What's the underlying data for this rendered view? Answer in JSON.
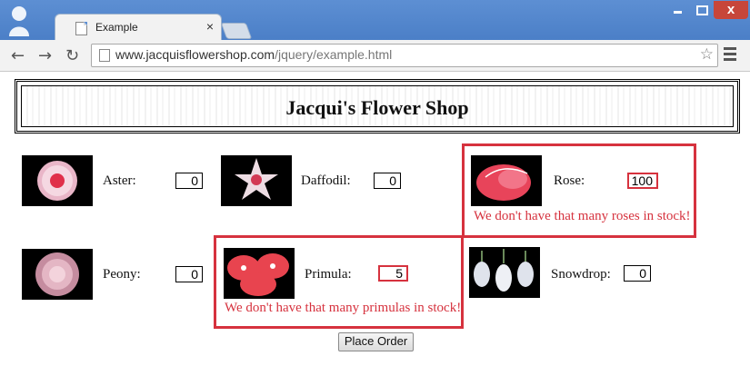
{
  "browser": {
    "tab_title": "Example",
    "tab_close": "×",
    "url_host": "www.jacquisflowershop.com",
    "url_path": "/jquery/example.html",
    "back_icon": "back-arrow-icon",
    "forward_icon": "forward-arrow-icon",
    "reload_icon": "reload-icon",
    "star_icon": "bookmark-star-icon",
    "menu_icon": "hamburger-menu-icon",
    "close_label": "x"
  },
  "shop": {
    "title": "Jacqui's Flower Shop",
    "order_button": "Place Order"
  },
  "flowers": {
    "aster": {
      "label": "Aster:",
      "value": "0"
    },
    "daffodil": {
      "label": "Daffodil:",
      "value": "0"
    },
    "rose": {
      "label": "Rose:",
      "value": "100",
      "error": "We don't have that many roses in stock!"
    },
    "peony": {
      "label": "Peony:",
      "value": "0"
    },
    "primula": {
      "label": "Primula:",
      "value": "5",
      "error": "We don't have that many primulas in stock!"
    },
    "snowdrop": {
      "label": "Snowdrop:",
      "value": "0"
    }
  },
  "colors": {
    "error": "#d6323e",
    "titlebar": "#5d8fd3"
  }
}
